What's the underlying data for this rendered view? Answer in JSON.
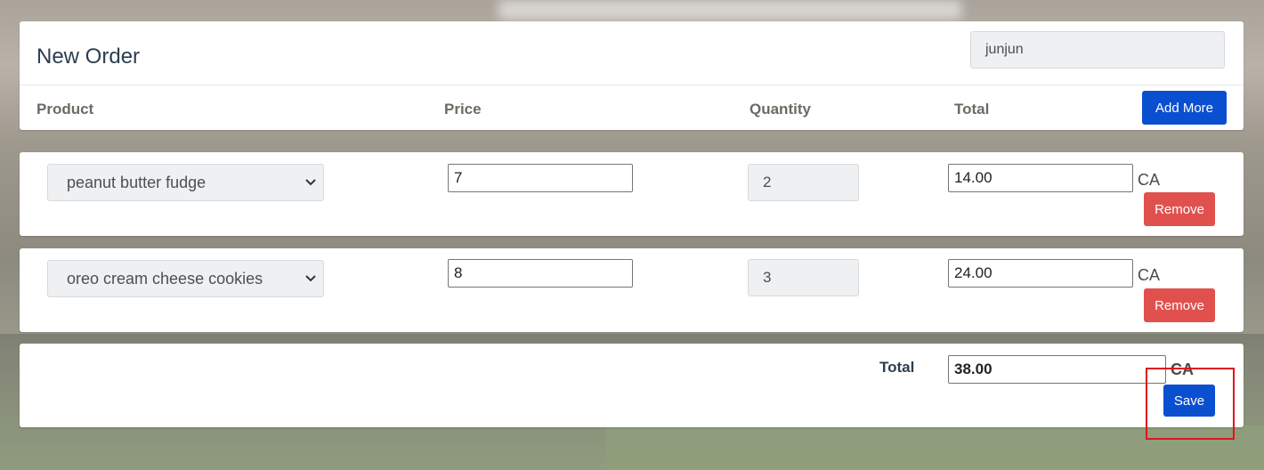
{
  "header": {
    "title": "New Order",
    "user_value": "junjun",
    "columns": [
      "Product",
      "Price",
      "Quantity",
      "Total"
    ],
    "add_more_label": "Add More"
  },
  "rows": [
    {
      "product": "peanut butter fudge",
      "price": "7",
      "quantity": "2",
      "total": "14.00",
      "currency": "CA",
      "remove_label": "Remove"
    },
    {
      "product": "oreo cream cheese cookies",
      "price": "8",
      "quantity": "3",
      "total": "24.00",
      "currency": "CA",
      "remove_label": "Remove"
    }
  ],
  "footer": {
    "total_label": "Total",
    "grand_total": "38.00",
    "currency": "CA",
    "save_label": "Save"
  },
  "colors": {
    "primary": "#0b4fd1",
    "danger": "#e0514e",
    "highlight": "#e0141c"
  },
  "icons": {
    "select_arrow": "chevron-down-icon"
  }
}
